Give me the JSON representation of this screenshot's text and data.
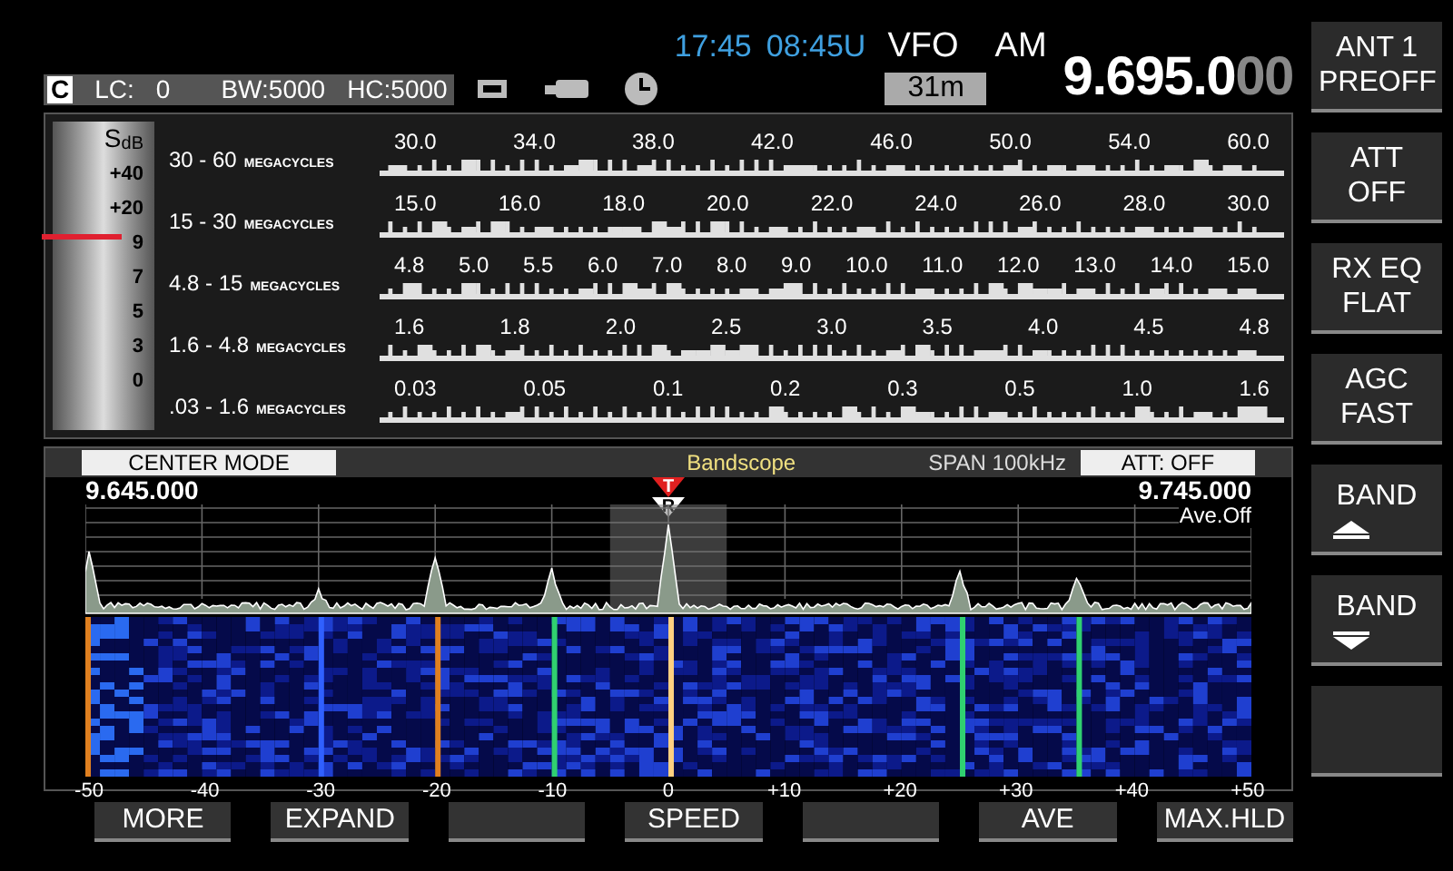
{
  "header": {
    "local_time": "17:45",
    "utc_time": "08:45U",
    "vfo": "VFO",
    "mode": "AM",
    "band": "31m",
    "frequency_main": "9.695.0",
    "frequency_sub": "00"
  },
  "status": {
    "memory": "C",
    "lc_label": "LC:",
    "lc_value": "0",
    "bw": "BW:5000",
    "hc": "HC:5000"
  },
  "s_meter": {
    "unit_s": "S",
    "unit_db": "dB",
    "scale": [
      "+40",
      "+20",
      "9",
      "7",
      "5",
      "3",
      "0"
    ],
    "level": 0.62
  },
  "dial_rows": [
    {
      "range": "30 - 60",
      "unit": "MEGACYCLES",
      "marks": [
        "30.0",
        "34.0",
        "38.0",
        "42.0",
        "46.0",
        "50.0",
        "54.0",
        "60.0"
      ]
    },
    {
      "range": "15 - 30",
      "unit": "MEGACYCLES",
      "marks": [
        "15.0",
        "16.0",
        "18.0",
        "20.0",
        "22.0",
        "24.0",
        "26.0",
        "28.0",
        "30.0"
      ]
    },
    {
      "range": "4.8 - 15",
      "unit": "MEGACYCLES",
      "marks": [
        "4.8",
        "5.0",
        "5.5",
        "6.0",
        "7.0",
        "8.0",
        "9.0",
        "10.0",
        "11.0",
        "12.0",
        "13.0",
        "14.0",
        "15.0"
      ]
    },
    {
      "range": "1.6 - 4.8",
      "unit": "MEGACYCLES",
      "marks": [
        "1.6",
        "1.8",
        "2.0",
        "2.5",
        "3.0",
        "3.5",
        "4.0",
        "4.5",
        "4.8"
      ]
    },
    {
      "range": ".03 - 1.6",
      "unit": "MEGACYCLES",
      "marks": [
        "0.03",
        "0.05",
        "0.1",
        "0.2",
        "0.3",
        "0.5",
        "1.0",
        "1.6"
      ]
    }
  ],
  "bandscope": {
    "mode": "CENTER MODE",
    "title": "Bandscope",
    "span": "SPAN 100kHz",
    "att": "ATT: OFF",
    "freq_low": "9.645.000",
    "freq_high": "9.745.000",
    "average": "Ave.Off",
    "tx_marker": "T",
    "rx_marker": "R",
    "axis": [
      "-50",
      "-40",
      "-30",
      "-20",
      "-10",
      "0",
      "+10",
      "+20",
      "+30",
      "+40",
      "+50"
    ]
  },
  "side_buttons": [
    {
      "kind": "text",
      "lines": [
        "ANT 1",
        "PREOFF"
      ]
    },
    {
      "kind": "text",
      "lines": [
        "ATT",
        "OFF"
      ]
    },
    {
      "kind": "text",
      "lines": [
        "RX EQ",
        "FLAT"
      ]
    },
    {
      "kind": "text",
      "lines": [
        "AGC",
        "FAST"
      ]
    },
    {
      "kind": "band-up",
      "lines": [
        "BAND"
      ]
    },
    {
      "kind": "band-down",
      "lines": [
        "BAND"
      ]
    },
    {
      "kind": "blank"
    }
  ],
  "bottom_buttons": [
    {
      "kind": "labeled",
      "label": "MORE"
    },
    {
      "kind": "labeled",
      "label": "EXPAND"
    },
    {
      "kind": "blank"
    },
    {
      "kind": "labeled",
      "label": "SPEED"
    },
    {
      "kind": "blank"
    },
    {
      "kind": "labeled",
      "label": "AVE"
    },
    {
      "kind": "labeled",
      "label": "MAX.HLD"
    }
  ]
}
